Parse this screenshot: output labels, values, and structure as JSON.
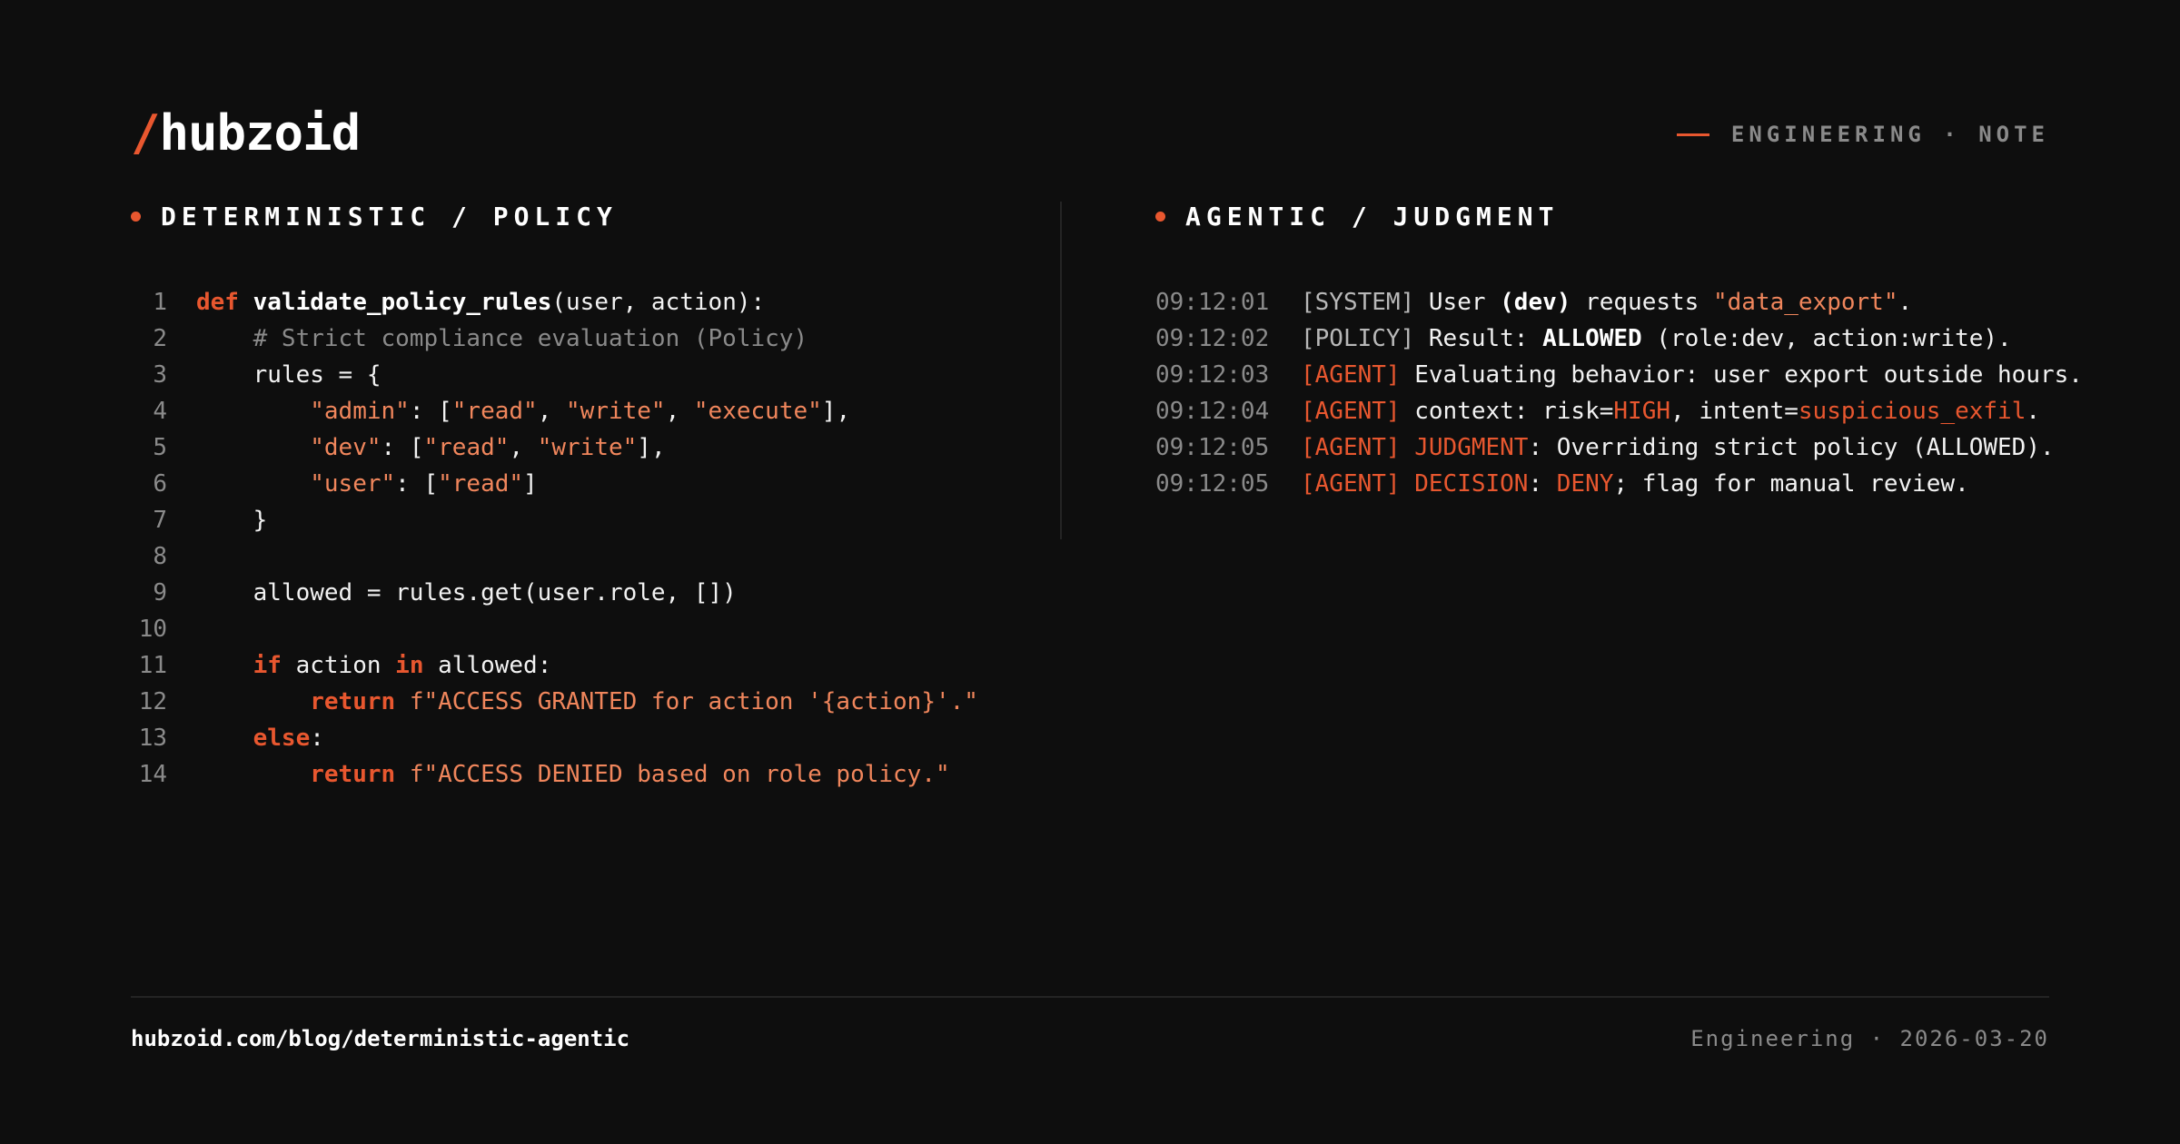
{
  "brand": {
    "slash": "/",
    "name": "hubzoid"
  },
  "eyebrow": "ENGINEERING · NOTE",
  "left_section": {
    "title": "DETERMINISTIC / POLICY"
  },
  "right_section": {
    "title": "AGENTIC / JUDGMENT"
  },
  "code_lines": [
    {
      "n": "1",
      "tokens": [
        [
          "kw",
          "def"
        ],
        [
          "pl",
          " "
        ],
        [
          "fn",
          "validate_policy_rules"
        ],
        [
          "pl",
          "(user, action):"
        ]
      ]
    },
    {
      "n": "2",
      "tokens": [
        [
          "pl",
          "    "
        ],
        [
          "cm",
          "# Strict compliance evaluation (Policy)"
        ]
      ]
    },
    {
      "n": "3",
      "tokens": [
        [
          "pl",
          "    rules = {"
        ]
      ]
    },
    {
      "n": "4",
      "tokens": [
        [
          "pl",
          "        "
        ],
        [
          "str",
          "\"admin\""
        ],
        [
          "pl",
          ": ["
        ],
        [
          "str",
          "\"read\""
        ],
        [
          "pl",
          ", "
        ],
        [
          "str",
          "\"write\""
        ],
        [
          "pl",
          ", "
        ],
        [
          "str",
          "\"execute\""
        ],
        [
          "pl",
          "],"
        ]
      ]
    },
    {
      "n": "5",
      "tokens": [
        [
          "pl",
          "        "
        ],
        [
          "str",
          "\"dev\""
        ],
        [
          "pl",
          ": ["
        ],
        [
          "str",
          "\"read\""
        ],
        [
          "pl",
          ", "
        ],
        [
          "str",
          "\"write\""
        ],
        [
          "pl",
          "],"
        ]
      ]
    },
    {
      "n": "6",
      "tokens": [
        [
          "pl",
          "        "
        ],
        [
          "str",
          "\"user\""
        ],
        [
          "pl",
          ": ["
        ],
        [
          "str",
          "\"read\""
        ],
        [
          "pl",
          "]"
        ]
      ]
    },
    {
      "n": "7",
      "tokens": [
        [
          "pl",
          "    }"
        ]
      ]
    },
    {
      "n": "8",
      "tokens": []
    },
    {
      "n": "9",
      "tokens": [
        [
          "pl",
          "    allowed = rules.get(user.role, [])"
        ]
      ]
    },
    {
      "n": "10",
      "tokens": []
    },
    {
      "n": "11",
      "tokens": [
        [
          "pl",
          "    "
        ],
        [
          "kw",
          "if"
        ],
        [
          "pl",
          " action "
        ],
        [
          "kw",
          "in"
        ],
        [
          "pl",
          " allowed:"
        ]
      ]
    },
    {
      "n": "12",
      "tokens": [
        [
          "pl",
          "        "
        ],
        [
          "kw",
          "return"
        ],
        [
          "pl",
          " "
        ],
        [
          "str",
          "f\"ACCESS GRANTED for action '{action}'.\""
        ]
      ]
    },
    {
      "n": "13",
      "tokens": [
        [
          "pl",
          "    "
        ],
        [
          "kw",
          "else"
        ],
        [
          "pl",
          ":"
        ]
      ]
    },
    {
      "n": "14",
      "tokens": [
        [
          "pl",
          "        "
        ],
        [
          "kw",
          "return"
        ],
        [
          "pl",
          " "
        ],
        [
          "str",
          "f\"ACCESS DENIED based on role policy.\""
        ]
      ]
    }
  ],
  "log_lines": [
    {
      "ts": "09:12:01",
      "tokens": [
        [
          "tag-sys",
          "[SYSTEM]"
        ],
        [
          "pl",
          " User "
        ],
        [
          "strong",
          "(dev)"
        ],
        [
          "pl",
          " requests "
        ],
        [
          "str",
          "\"data_export\""
        ],
        [
          "pl",
          "."
        ]
      ]
    },
    {
      "ts": "09:12:02",
      "tokens": [
        [
          "tag-sys",
          "[POLICY]"
        ],
        [
          "pl",
          " Result: "
        ],
        [
          "strong",
          "ALLOWED"
        ],
        [
          "pl",
          " (role:dev, action:write)."
        ]
      ]
    },
    {
      "ts": "09:12:03",
      "tokens": [
        [
          "tag-agent",
          "[AGENT]"
        ],
        [
          "pl",
          " Evaluating behavior: user export outside hours."
        ]
      ]
    },
    {
      "ts": "09:12:04",
      "tokens": [
        [
          "tag-agent",
          "[AGENT]"
        ],
        [
          "pl",
          " context: risk="
        ],
        [
          "hl",
          "HIGH"
        ],
        [
          "pl",
          ", intent="
        ],
        [
          "hl",
          "suspicious_exfil"
        ],
        [
          "pl",
          "."
        ]
      ]
    },
    {
      "ts": "09:12:05",
      "tokens": [
        [
          "tag-agent",
          "[AGENT]"
        ],
        [
          "pl",
          " "
        ],
        [
          "hl",
          "JUDGMENT"
        ],
        [
          "pl",
          ": Overriding strict policy (ALLOWED)."
        ]
      ]
    },
    {
      "ts": "09:12:05",
      "tokens": [
        [
          "tag-agent",
          "[AGENT]"
        ],
        [
          "pl",
          " "
        ],
        [
          "hl",
          "DECISION"
        ],
        [
          "pl",
          ": "
        ],
        [
          "hl",
          "DENY"
        ],
        [
          "pl",
          "; flag for manual review."
        ]
      ]
    }
  ],
  "footer": {
    "url": "hubzoid.com/blog/deterministic-agentic",
    "meta": "Engineering · 2026-03-20"
  },
  "colors": {
    "accent": "#e8572f",
    "string": "#f0865c",
    "muted": "#8a8a8a",
    "background": "#0e0e0e"
  }
}
